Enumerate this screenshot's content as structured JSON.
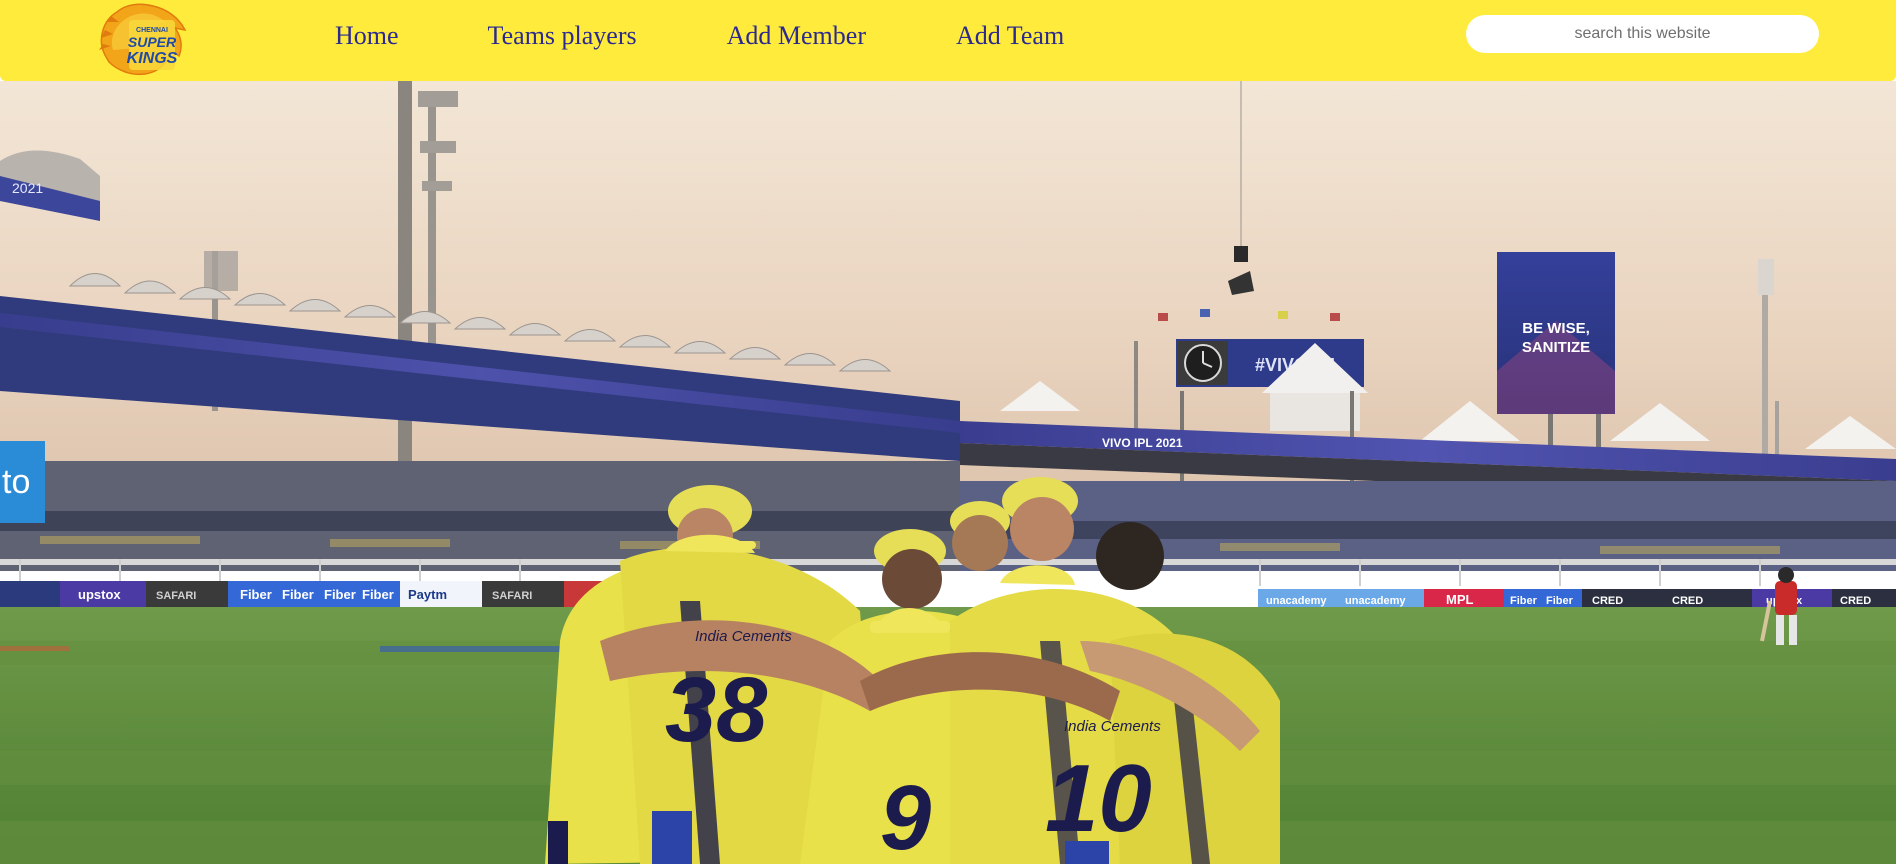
{
  "header": {
    "logo": {
      "alt": "Chennai Super Kings logo",
      "line1": "CHENNAI",
      "line2": "SUPER",
      "line3": "KINGS"
    },
    "nav": [
      {
        "label": "Home"
      },
      {
        "label": "Teams players"
      },
      {
        "label": "Add Member"
      },
      {
        "label": "Add Team"
      }
    ],
    "search": {
      "placeholder": "search this website",
      "value": ""
    }
  },
  "hero": {
    "alt": "Team huddle on the cricket field in a stadium",
    "billboard_top": "BE WISE,",
    "billboard_bottom": "SANITIZE",
    "scoreboard_text": "#VIVO IPL",
    "stand_banner": "VIVO IPL 2021",
    "stand_banner_left": "2021",
    "jersey_sponsor": "India Cements",
    "jersey_numbers": [
      "38",
      "9",
      "10"
    ],
    "ad_boards": [
      "Fiber",
      "Fiber",
      "Fiber",
      "Fiber",
      "Paytm",
      "unacademy",
      "unacademy",
      "MPL",
      "Fiber",
      "Fiber",
      "CRED",
      "CRED",
      "upstox",
      "upstox",
      "CRED",
      "SAFARI",
      "SAFARI",
      "to"
    ]
  },
  "colors": {
    "header_bg": "#ffeb3b",
    "nav_text": "#2c2a8f",
    "jersey_yellow": "#e9e14a",
    "jersey_navy": "#1c1b4d",
    "pitch_green": "#5b8a3c",
    "sky_top": "#f3e6d6"
  }
}
